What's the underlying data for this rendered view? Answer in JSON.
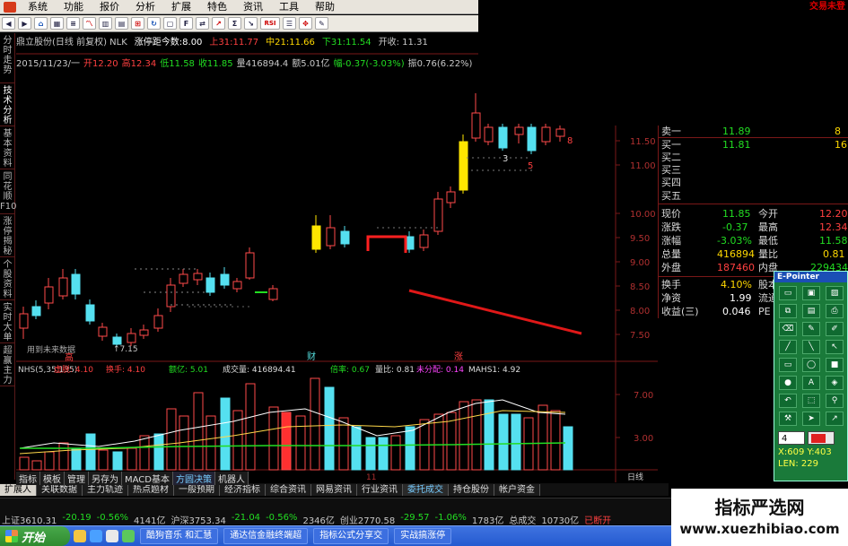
{
  "menu": [
    "系统",
    "功能",
    "报价",
    "分析",
    "扩展",
    "特色",
    "资讯",
    "工具",
    "帮助"
  ],
  "broker": "交易未登",
  "toolbar": {
    "rsi_label": "RSI"
  },
  "left_tabs": [
    "分时走势",
    "技术分析",
    "基本资料",
    "同花顺F10",
    "涨停揭秘",
    "个股资料",
    "实时大单",
    "超赢主力"
  ],
  "header": {
    "stock": "鼎立股份(日线 前复权) NLK",
    "limit_label": "涨停距今数:",
    "limit_value": "8.00",
    "up": "上31:11.77",
    "mid": "中21:11.66",
    "down": "下31:11.54",
    "open": "开收: 11.31"
  },
  "ohlc": {
    "date": "2015/11/23/一",
    "open": "开12.20",
    "high": "高12.34",
    "low": "低11.58",
    "close": "收11.85",
    "vol": "量416894.4",
    "amount": "额5.01亿",
    "change": "幅-0.37(-3.03%)",
    "amp": "振0.76(6.22%)"
  },
  "chart_data": [
    {
      "type": "candlestick",
      "title": "鼎立股份(日线 前复权)",
      "y_ticks": [
        "11.50",
        "11.00",
        "10.00",
        "9.50",
        "9.00",
        "8.50",
        "8.00",
        "7.50"
      ],
      "annotations": [
        "↑7.15",
        "用到未来数据",
        "高",
        "财",
        "涨",
        "3",
        "5",
        "8"
      ]
    },
    {
      "type": "bar",
      "title": "NHS(5,35,135)",
      "y_ticks": [
        "7.00",
        "3.00"
      ],
      "x_ticks": [
        "2015年",
        "10",
        "11"
      ],
      "legend": [
        "虚脱: 4.10",
        "换手: 4.10",
        "额亿: 5.01",
        "成交量: 416894.41",
        "倍率: 0.67",
        "量比: 0.81",
        "未分配: 0.14",
        "MAHS1: 4.92"
      ]
    }
  ],
  "quote": {
    "sell1": {
      "label": "卖一",
      "price": "11.89",
      "vol": "8"
    },
    "buy1": {
      "label": "买一",
      "price": "11.81",
      "vol": "16"
    },
    "buy_labels": [
      "买二",
      "买三",
      "买四",
      "买五"
    ],
    "now": {
      "label": "现价",
      "value": "11.85",
      "label2": "今开",
      "value2": "12.20"
    },
    "chg": {
      "label": "涨跌",
      "value": "-0.37",
      "label2": "最高",
      "value2": "12.34"
    },
    "pct": {
      "label": "涨幅",
      "value": "-3.03%",
      "label2": "最低",
      "value2": "11.58"
    },
    "vol": {
      "label": "总量",
      "value": "416894",
      "label2": "量比",
      "value2": "0.81"
    },
    "outer": {
      "label": "外盘",
      "value": "187460",
      "label2": "内盘",
      "value2": "229434"
    },
    "turnover": {
      "label": "换手",
      "value": "4.10%",
      "label2": "股本"
    },
    "nav": {
      "label": "净资",
      "value": "1.99",
      "label2": "流通"
    },
    "eps": {
      "label": "收益(三)",
      "value": "0.046",
      "label2": "PE"
    }
  },
  "palette": {
    "title": "E-Pointer",
    "line_width": "4",
    "x": "X:609",
    "y": "Y:403",
    "len": "LEN: 229"
  },
  "period": {
    "day": "日线",
    "adj": "除权"
  },
  "tabs": [
    "扩展人",
    "关联数据",
    "主力轨迹",
    "热点题材",
    "一般预期",
    "经济指标",
    "综合资讯",
    "网易资讯",
    "行业资讯",
    "委托成交",
    "持仓股份",
    "帐户资金"
  ],
  "tab_labels_first": [
    "指标",
    "模板",
    "管理",
    "另存为",
    "MACD基本",
    "方圆决策",
    "机器人"
  ],
  "ticker": {
    "sh": "上证3610.31",
    "sh_chg": "-20.19",
    "sh_pct": "-0.56%",
    "sh_amt": "4141亿",
    "hs": "沪深3753.34",
    "hs_chg": "-21.04",
    "hs_pct": "-0.56%",
    "hs_amt": "2346亿",
    "cy": "创业2770.58",
    "cy_chg": "-29.57",
    "cy_pct": "-1.06%",
    "cy_amt": "1783亿",
    "total": "总成交",
    "total_amt": "10730亿",
    "status": "已断开"
  },
  "taskbar": {
    "start": "开始",
    "tasks": [
      "酷狗音乐 和汇慧",
      "通达信金融终端超",
      "指标公式分享交",
      "实战搞涨停"
    ]
  },
  "watermark": {
    "cn": "指标严选网",
    "url": "www.xuezhibiao.com"
  }
}
